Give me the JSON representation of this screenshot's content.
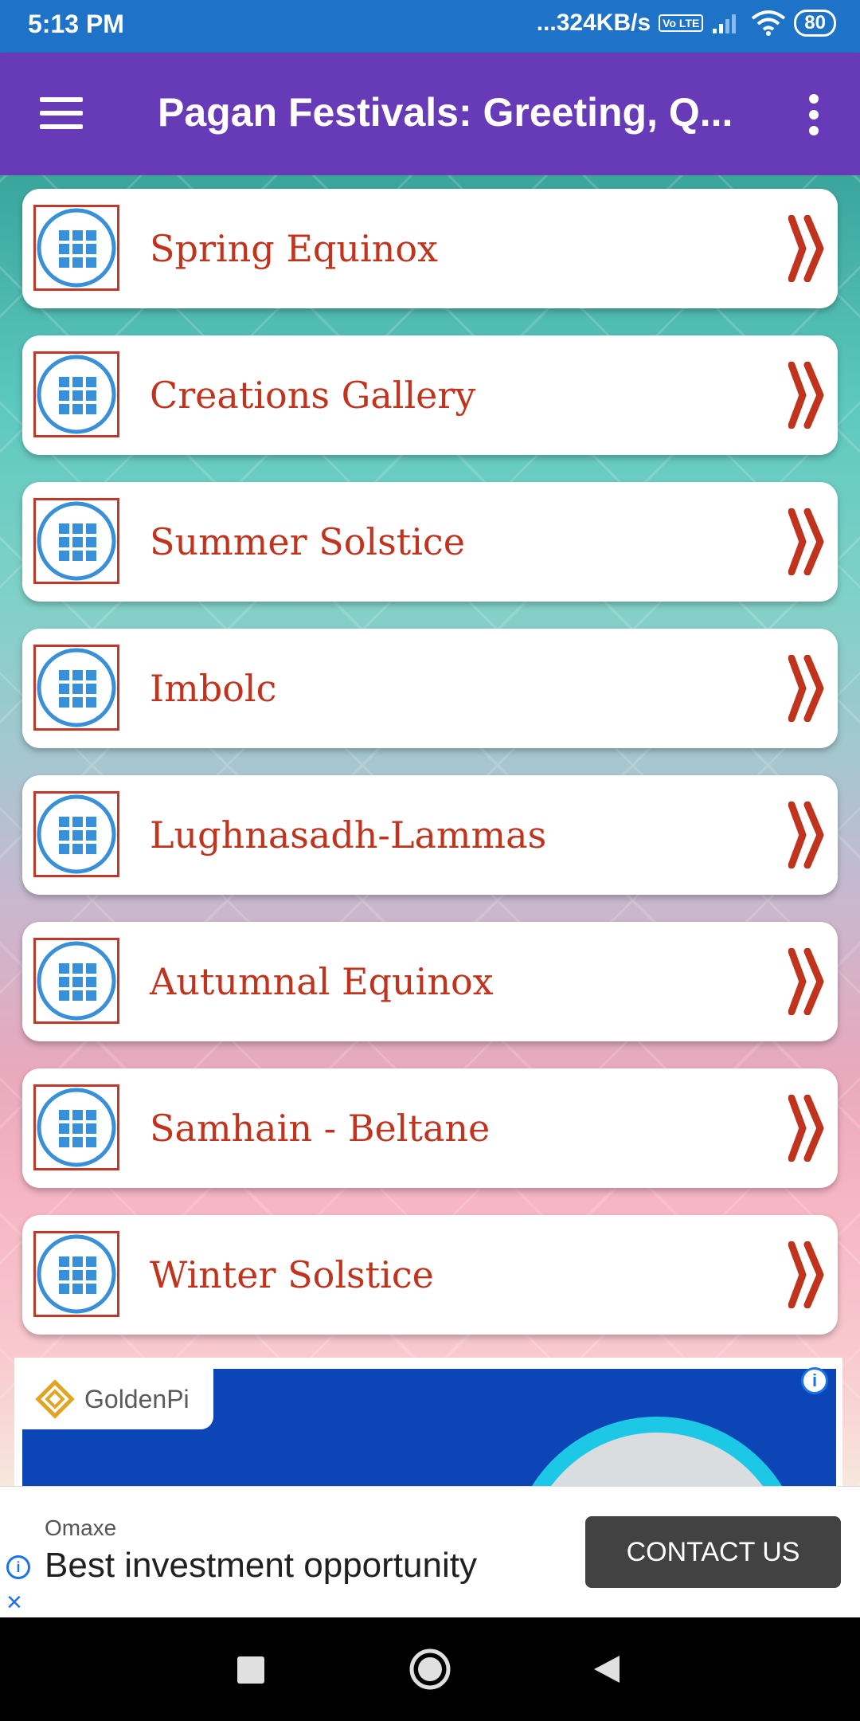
{
  "status_bar": {
    "time": "5:13 PM",
    "network_speed": "...324KB/s",
    "volte": "Vo LTE",
    "battery": "80",
    "icons": [
      "signal-icon",
      "wifi-icon",
      "battery-icon"
    ]
  },
  "app_bar": {
    "title": "Pagan Festivals: Greeting, Q...",
    "background": "#673ab7"
  },
  "menu": {
    "items": [
      {
        "label": "Spring Equinox"
      },
      {
        "label": "Creations Gallery"
      },
      {
        "label": "Summer Solstice"
      },
      {
        "label": "Imbolc"
      },
      {
        "label": "Lughnasadh-Lammas"
      },
      {
        "label": "Autumnal Equinox"
      },
      {
        "label": "Samhain - Beltane"
      },
      {
        "label": "Winter Solstice"
      }
    ],
    "label_color": "#c0341e",
    "icon_color": "#3a8fd9"
  },
  "banner_ad": {
    "brand": "GoldenPi",
    "adchoices": "i"
  },
  "bottom_ad": {
    "advertiser": "Omaxe",
    "headline": "Best investment opportunity",
    "cta": "CONTACT US",
    "info": "i",
    "close": "×"
  }
}
